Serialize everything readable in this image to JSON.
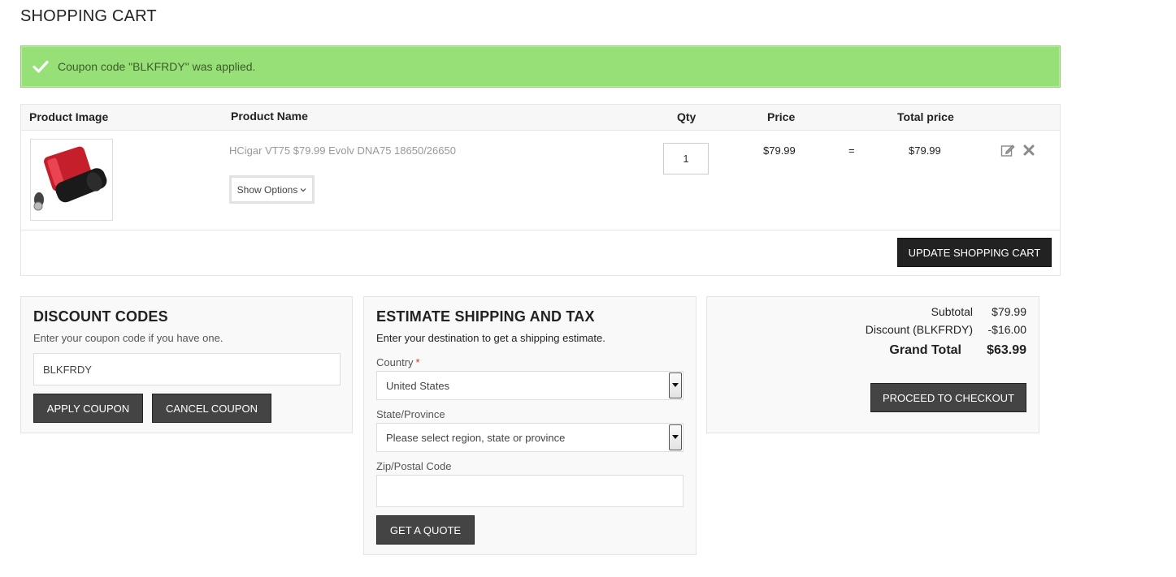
{
  "page": {
    "title": "SHOPPING CART"
  },
  "message": {
    "text": "Coupon code \"BLKFRDY\" was applied."
  },
  "cart": {
    "headers": {
      "image": "Product Image",
      "name": "Product Name",
      "qty": "Qty",
      "price": "Price",
      "total": "Total price"
    },
    "items": [
      {
        "name": "HCigar VT75 $79.99 Evolv DNA75 18650/26650",
        "options_label": "Show Options",
        "qty": "1",
        "price": "$79.99",
        "equals": "=",
        "total": "$79.99"
      }
    ],
    "update_label": "UPDATE SHOPPING CART"
  },
  "discount": {
    "title": "DISCOUNT CODES",
    "subtitle": "Enter your coupon code if you have one.",
    "code_value": "BLKFRDY",
    "apply_label": "APPLY COUPON",
    "cancel_label": "CANCEL COUPON"
  },
  "shipping": {
    "title": "ESTIMATE SHIPPING AND TAX",
    "subtitle": "Enter your destination to get a shipping estimate.",
    "country_label": "Country",
    "required_mark": "*",
    "country_value": "United States",
    "state_label": "State/Province",
    "state_value": "Please select region, state or province",
    "zip_label": "Zip/Postal Code",
    "zip_value": "",
    "quote_label": "GET A QUOTE"
  },
  "totals": {
    "subtotal_label": "Subtotal",
    "subtotal_value": "$79.99",
    "discount_label": "Discount (BLKFRDY)",
    "discount_value": "-$16.00",
    "grand_label": "Grand Total",
    "grand_value": "$63.99",
    "checkout_label": "PROCEED TO CHECKOUT"
  },
  "colors": {
    "success_bg": "#96e077",
    "button_dark": "#444444",
    "button_black": "#222222"
  },
  "icons": [
    "checkmark-icon",
    "edit-icon",
    "remove-icon",
    "chevron-down-icon",
    "select-arrow-icon"
  ]
}
